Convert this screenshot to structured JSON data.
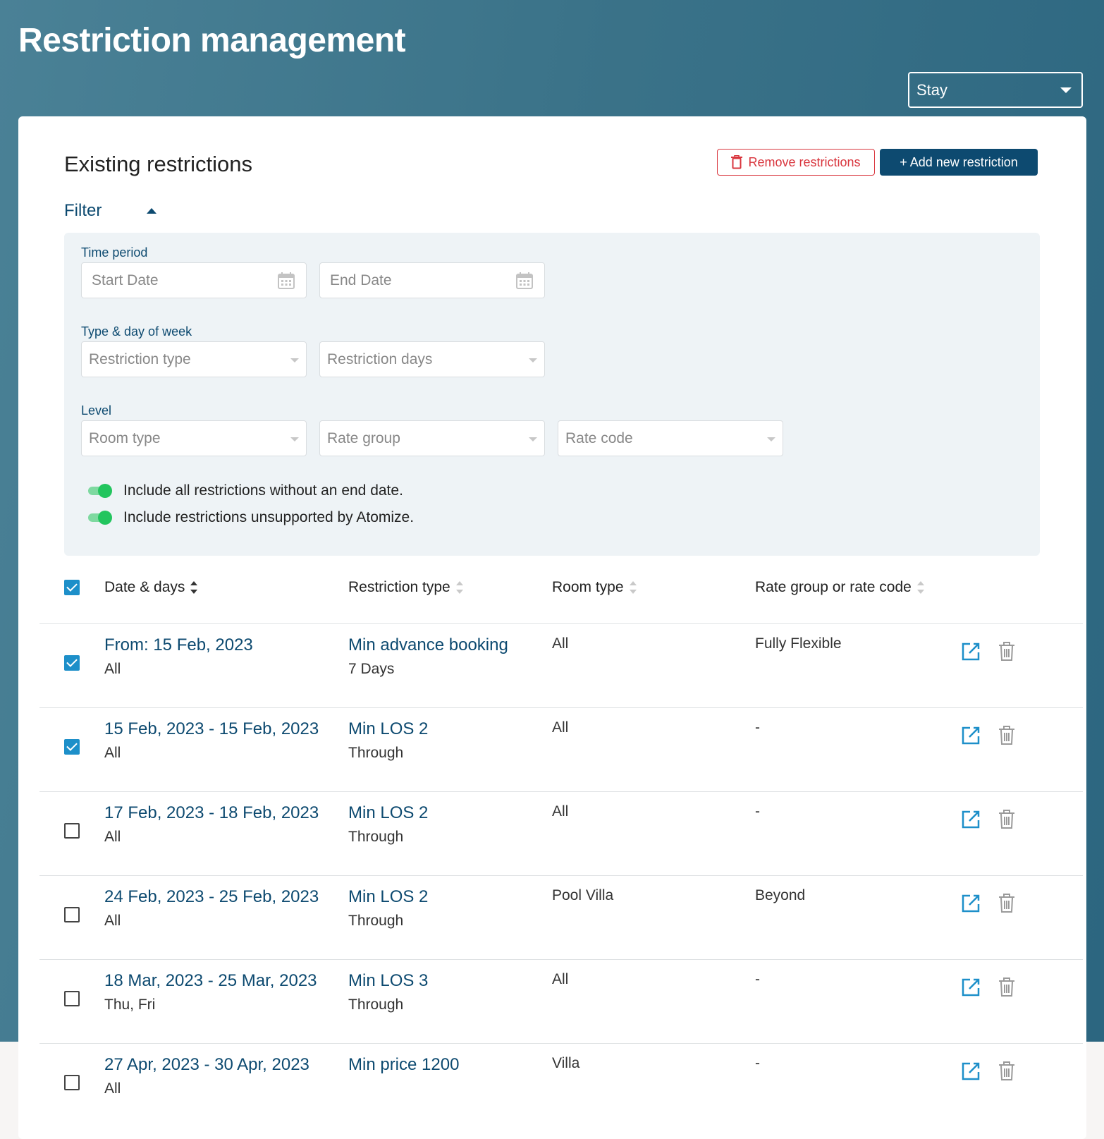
{
  "header": {
    "title": "Restriction management"
  },
  "view_select": {
    "value": "Stay"
  },
  "card": {
    "title": "Existing restrictions",
    "remove_label": "Remove restrictions",
    "add_label": "+ Add new restriction"
  },
  "filter": {
    "toggle_label": "Filter",
    "time_period_label": "Time period",
    "start_date_placeholder": "Start Date",
    "end_date_placeholder": "End Date",
    "type_day_label": "Type & day of week",
    "restriction_type_placeholder": "Restriction type",
    "restriction_days_placeholder": "Restriction days",
    "level_label": "Level",
    "room_type_placeholder": "Room type",
    "rate_group_placeholder": "Rate group",
    "rate_code_placeholder": "Rate code",
    "toggles": [
      {
        "label": "Include all restrictions without an end date.",
        "on": true
      },
      {
        "label": "Include restrictions unsupported by Atomize.",
        "on": true
      }
    ]
  },
  "table": {
    "columns": [
      "Date & days",
      "Restriction type",
      "Room type",
      "Rate group or rate code"
    ],
    "header_checked": true,
    "rows": [
      {
        "checked": true,
        "date": "From: 15 Feb, 2023",
        "days": "All",
        "type": "Min advance booking",
        "type_sub": "7 Days",
        "room": "All",
        "rate": "Fully Flexible"
      },
      {
        "checked": true,
        "date": "15 Feb, 2023 - 15 Feb, 2023",
        "days": "All",
        "type": "Min LOS 2",
        "type_sub": "Through",
        "room": "All",
        "rate": "-"
      },
      {
        "checked": false,
        "date": "17 Feb, 2023 - 18 Feb, 2023",
        "days": "All",
        "type": "Min LOS 2",
        "type_sub": "Through",
        "room": "All",
        "rate": "-"
      },
      {
        "checked": false,
        "date": "24 Feb, 2023 - 25 Feb, 2023",
        "days": "All",
        "type": "Min LOS 2",
        "type_sub": "Through",
        "room": "Pool Villa",
        "rate": "Beyond"
      },
      {
        "checked": false,
        "date": "18 Mar, 2023 - 25 Mar, 2023",
        "days": "Thu, Fri",
        "type": "Min LOS 3",
        "type_sub": "Through",
        "room": "All",
        "rate": "-"
      },
      {
        "checked": false,
        "date": "27 Apr, 2023 - 30 Apr, 2023",
        "days": "All",
        "type": "Min price 1200",
        "type_sub": "",
        "room": "Villa",
        "rate": "-"
      }
    ]
  },
  "colors": {
    "primary": "#0d4a70",
    "danger": "#d9363e",
    "accent": "#1d8fc9",
    "toggle_on": "#22c55e"
  },
  "icons": {
    "calendar": "calendar-icon",
    "trash": "trash-icon",
    "edit": "edit-icon",
    "sort": "sort-icon"
  }
}
